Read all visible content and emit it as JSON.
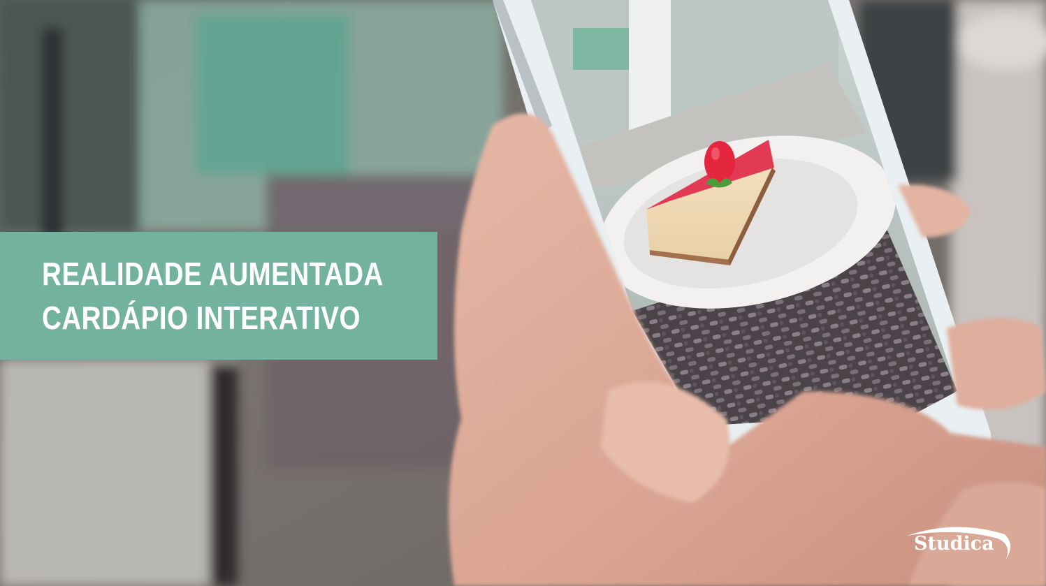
{
  "banner": {
    "line1": "REALIDADE AUMENTADA",
    "line2": "CARDÁPIO INTERATIVO",
    "background_color": "#74b2a0"
  },
  "logo": {
    "text": "Studica"
  }
}
